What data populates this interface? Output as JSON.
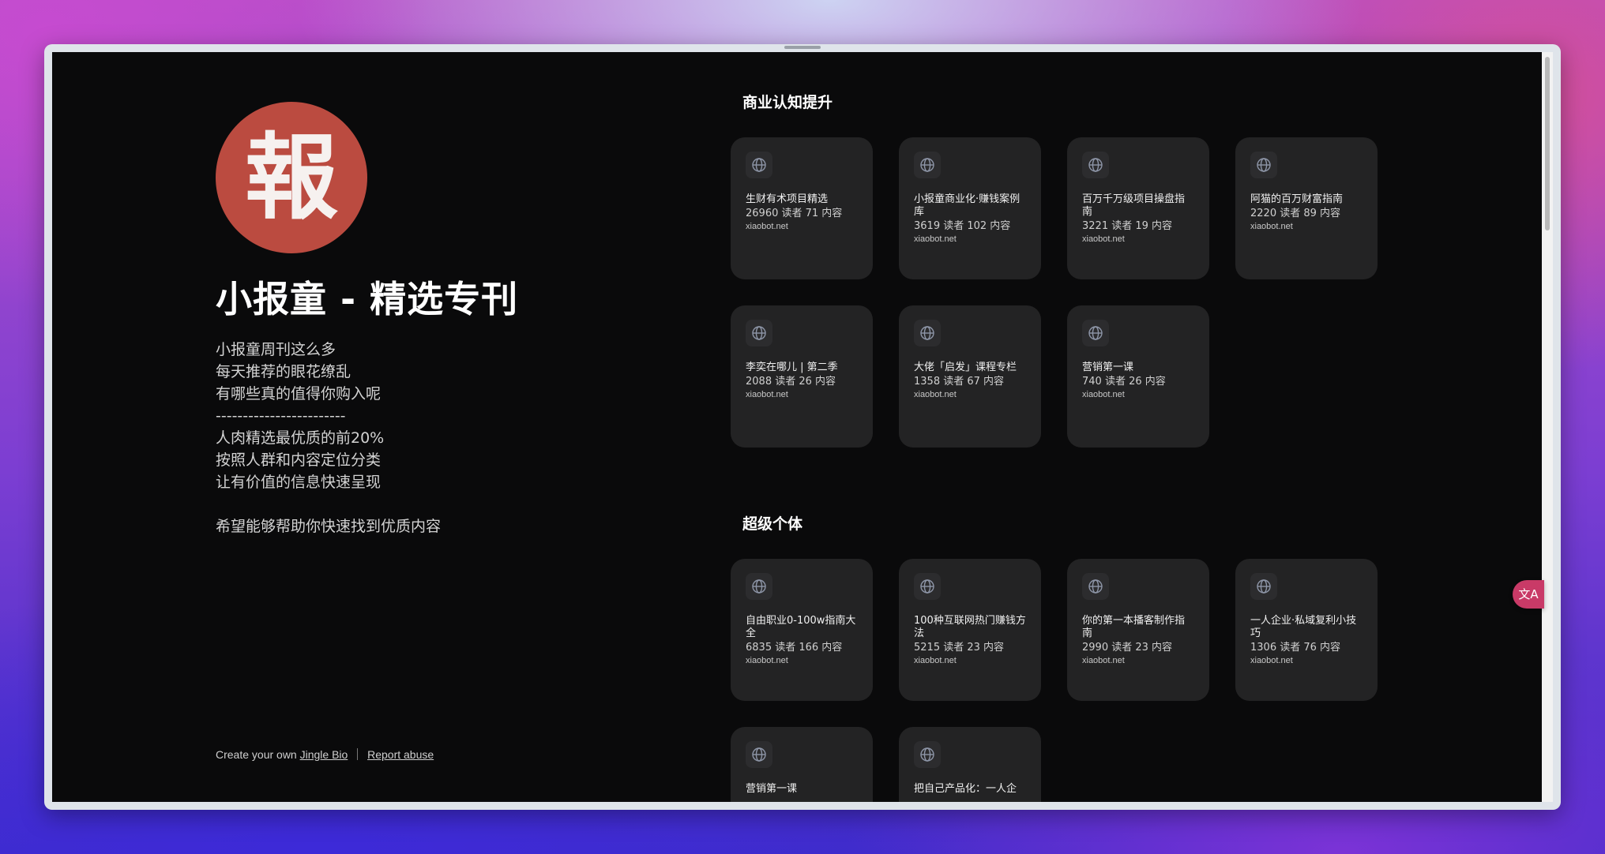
{
  "profile": {
    "avatar_char": "報",
    "title": "小报童 - 精选专刊",
    "description": "小报童周刊这么多\n每天推荐的眼花缭乱\n有哪些真的值得你购入呢\n------------------------\n人肉精选最优质的前20%\n按照人群和内容定位分类\n让有价值的信息快速呈现\n\n希望能够帮助你快速找到优质内容"
  },
  "footer": {
    "create_prefix": "Create your own",
    "create_link": "Jingle Bio",
    "report_link": "Report abuse"
  },
  "sections": [
    {
      "title": "商业认知提升",
      "cards": [
        {
          "name": "生财有术项目精选",
          "stats": "26960 读者 71 内容",
          "host": "xiaobot.net"
        },
        {
          "name": "小报童商业化·赚钱案例库",
          "stats": "3619 读者 102 内容",
          "host": "xiaobot.net"
        },
        {
          "name": "百万千万级项目操盘指南",
          "stats": "3221 读者 19 内容",
          "host": "xiaobot.net"
        },
        {
          "name": "阿猫的百万财富指南",
          "stats": "2220 读者 89 内容",
          "host": "xiaobot.net"
        },
        {
          "name": "李奕在哪儿 | 第二季",
          "stats": "2088 读者 26 内容",
          "host": "xiaobot.net"
        },
        {
          "name": "大佬「启发」课程专栏",
          "stats": "1358 读者 67 内容",
          "host": "xiaobot.net"
        },
        {
          "name": "营销第一课",
          "stats": "740 读者 26 内容",
          "host": "xiaobot.net"
        }
      ]
    },
    {
      "title": "超级个体",
      "cards": [
        {
          "name": "自由职业0-100w指南大全",
          "stats": "6835 读者 166 内容",
          "host": "xiaobot.net"
        },
        {
          "name": "100种互联网热门赚钱方法",
          "stats": "5215 读者 23 内容",
          "host": "xiaobot.net"
        },
        {
          "name": "你的第一本播客制作指南",
          "stats": "2990 读者 23 内容",
          "host": "xiaobot.net"
        },
        {
          "name": "一人企业·私域复利小技巧",
          "stats": "1306 读者 76 内容",
          "host": "xiaobot.net"
        },
        {
          "name": "营销第一课",
          "stats": "",
          "host": ""
        },
        {
          "name": "把自己产品化：一人企",
          "stats": "",
          "host": ""
        }
      ]
    }
  ],
  "icons": {
    "card_icon": "globe-icon",
    "translate": "translate-icon"
  },
  "colors": {
    "page_bg": "#0a0a0b",
    "card_bg": "#232324",
    "avatar_bg": "#bb4b40",
    "translate_btn": "#c93a67"
  }
}
